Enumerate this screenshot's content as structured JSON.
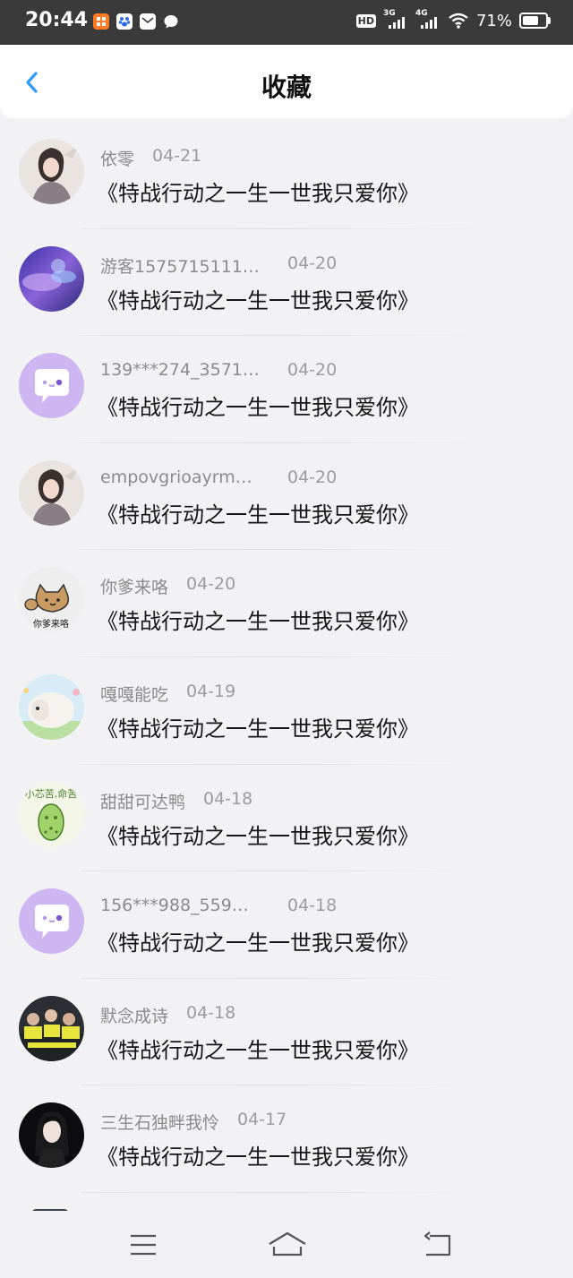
{
  "status_bar": {
    "time": "20:44",
    "hd": "HD",
    "net1": "3G",
    "net2": "4G",
    "battery": "71%",
    "battery_level": 0.71
  },
  "header": {
    "title": "收藏",
    "back_icon": "chevron-left-icon"
  },
  "items": [
    {
      "user": "依零",
      "date": "04-21",
      "book": "《特战行动之一生一世我只爱你》",
      "avatar": "photo-avatar"
    },
    {
      "user": "游客1575715111…",
      "date": "04-20",
      "book": "《特战行动之一生一世我只爱你》",
      "avatar": "galaxy-avatar"
    },
    {
      "user": "139***274_3571…",
      "date": "04-20",
      "book": "《特战行动之一生一世我只爱你》",
      "avatar": "default-chat-avatar"
    },
    {
      "user": "empovgrioayrm…",
      "date": "04-20",
      "book": "《特战行动之一生一世我只爱你》",
      "avatar": "photo-avatar"
    },
    {
      "user": "你爹来咯",
      "date": "04-20",
      "book": "《特战行动之一生一世我只爱你》",
      "avatar": "cat-sticker-avatar",
      "avatar_caption": "你爹来咯"
    },
    {
      "user": "嘎嘎能吃",
      "date": "04-19",
      "book": "《特战行动之一生一世我只爱你》",
      "avatar": "sheep-avatar"
    },
    {
      "user": "甜甜可达鸭",
      "date": "04-18",
      "book": "《特战行动之一生一世我只爱你》",
      "avatar": "bitter-melon-avatar",
      "avatar_caption": "小芯苦,命苦"
    },
    {
      "user": "156***988_559…",
      "date": "04-18",
      "book": "《特战行动之一生一世我只爱你》",
      "avatar": "default-chat-avatar"
    },
    {
      "user": "默念成诗",
      "date": "04-18",
      "book": "《特战行动之一生一世我只爱你》",
      "avatar": "group-photo-avatar"
    },
    {
      "user": "三生石独畔我怜",
      "date": "04-17",
      "book": "《特战行动之一生一世我只爱你》",
      "avatar": "portrait-avatar"
    }
  ],
  "nav": {
    "menu_icon": "menu-icon",
    "home_icon": "home-icon",
    "back_icon": "back-icon"
  },
  "colors": {
    "accent": "#2f9bf5",
    "default_avatar_bg": "#cdb6f2",
    "page_bg": "#f2f2f4"
  }
}
